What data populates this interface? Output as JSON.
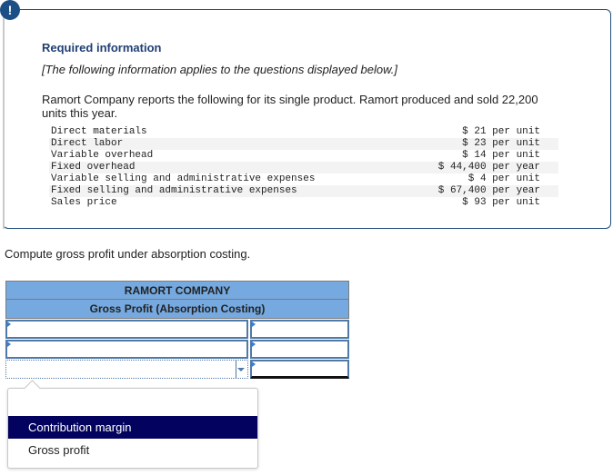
{
  "info": {
    "alert_icon": "!",
    "title": "Required information",
    "subtitle": "[The following information applies to the questions displayed below.]",
    "body": "Ramort Company reports the following for its single product. Ramort produced and sold 22,200 units this year.",
    "items": [
      {
        "label": "Direct materials",
        "value": "$ 21 per unit"
      },
      {
        "label": "Direct labor",
        "value": "$ 23 per unit"
      },
      {
        "label": "Variable overhead",
        "value": "$ 14 per unit"
      },
      {
        "label": "Fixed overhead",
        "value": "$ 44,400 per year"
      },
      {
        "label": "Variable selling and administrative expenses",
        "value": "$ 4 per unit"
      },
      {
        "label": "Fixed selling and administrative expenses",
        "value": "$ 67,400 per year"
      },
      {
        "label": "Sales price",
        "value": "$ 93 per unit"
      }
    ]
  },
  "question": "Compute gross profit under absorption costing.",
  "worksheet": {
    "company": "RAMORT COMPANY",
    "title": "Gross Profit (Absorption Costing)",
    "rows": [
      {
        "label": "",
        "amount": ""
      },
      {
        "label": "",
        "amount": ""
      },
      {
        "label": "",
        "amount": ""
      }
    ]
  },
  "dropdown": {
    "options": [
      "",
      "Contribution margin",
      "Gross profit"
    ],
    "highlighted": "Contribution margin"
  }
}
